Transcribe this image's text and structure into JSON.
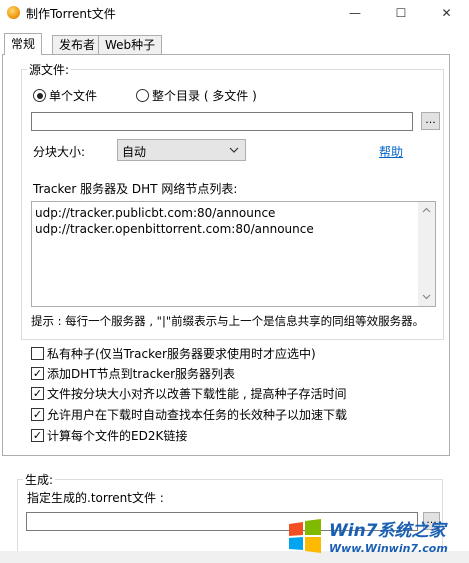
{
  "window": {
    "title": "制作Torrent文件",
    "controls": {
      "minimize": "—",
      "maximize": "☐",
      "close": "✕"
    }
  },
  "tabs": [
    {
      "label": "常规"
    },
    {
      "label": "发布者"
    },
    {
      "label": "Web种子"
    }
  ],
  "source": {
    "group_label": "源文件:",
    "radio_single": "单个文件",
    "radio_dir": "整个目录 ( 多文件 )",
    "path_value": "",
    "browse_label": "...",
    "piece_size_label": "分块大小:",
    "piece_size_value": "自动",
    "help_link": "帮助",
    "tracker_label": "Tracker 服务器及 DHT 网络节点列表:",
    "trackers": [
      "udp://tracker.publicbt.com:80/announce",
      "udp://tracker.openbittorrent.com:80/announce"
    ],
    "hint": "提示 : 每行一个服务器 , \"|\"前缀表示与上一个是信息共享的同组等效服务器。"
  },
  "options": [
    {
      "label": "私有种子(仅当Tracker服务器要求使用时才应选中)",
      "checked": false
    },
    {
      "label": "添加DHT节点到tracker服务器列表",
      "checked": true
    },
    {
      "label": "文件按分块大小对齐以改善下载性能 , 提高种子存活时间",
      "checked": true
    },
    {
      "label": "允许用户在下载时自动查找本任务的长效种子以加速下载",
      "checked": true
    },
    {
      "label": "计算每个文件的ED2K链接",
      "checked": true
    }
  ],
  "output": {
    "group_label": "生成:",
    "file_label": "指定生成的.torrent文件 :",
    "path_value": "",
    "browse_label": "..."
  },
  "watermark": {
    "brand": "Win7系统之家",
    "url": "Www.Winwin7.com"
  },
  "colors": {
    "accent_link": "#0066cc",
    "border": "#adadad",
    "panel_bg": "#ffffff"
  }
}
